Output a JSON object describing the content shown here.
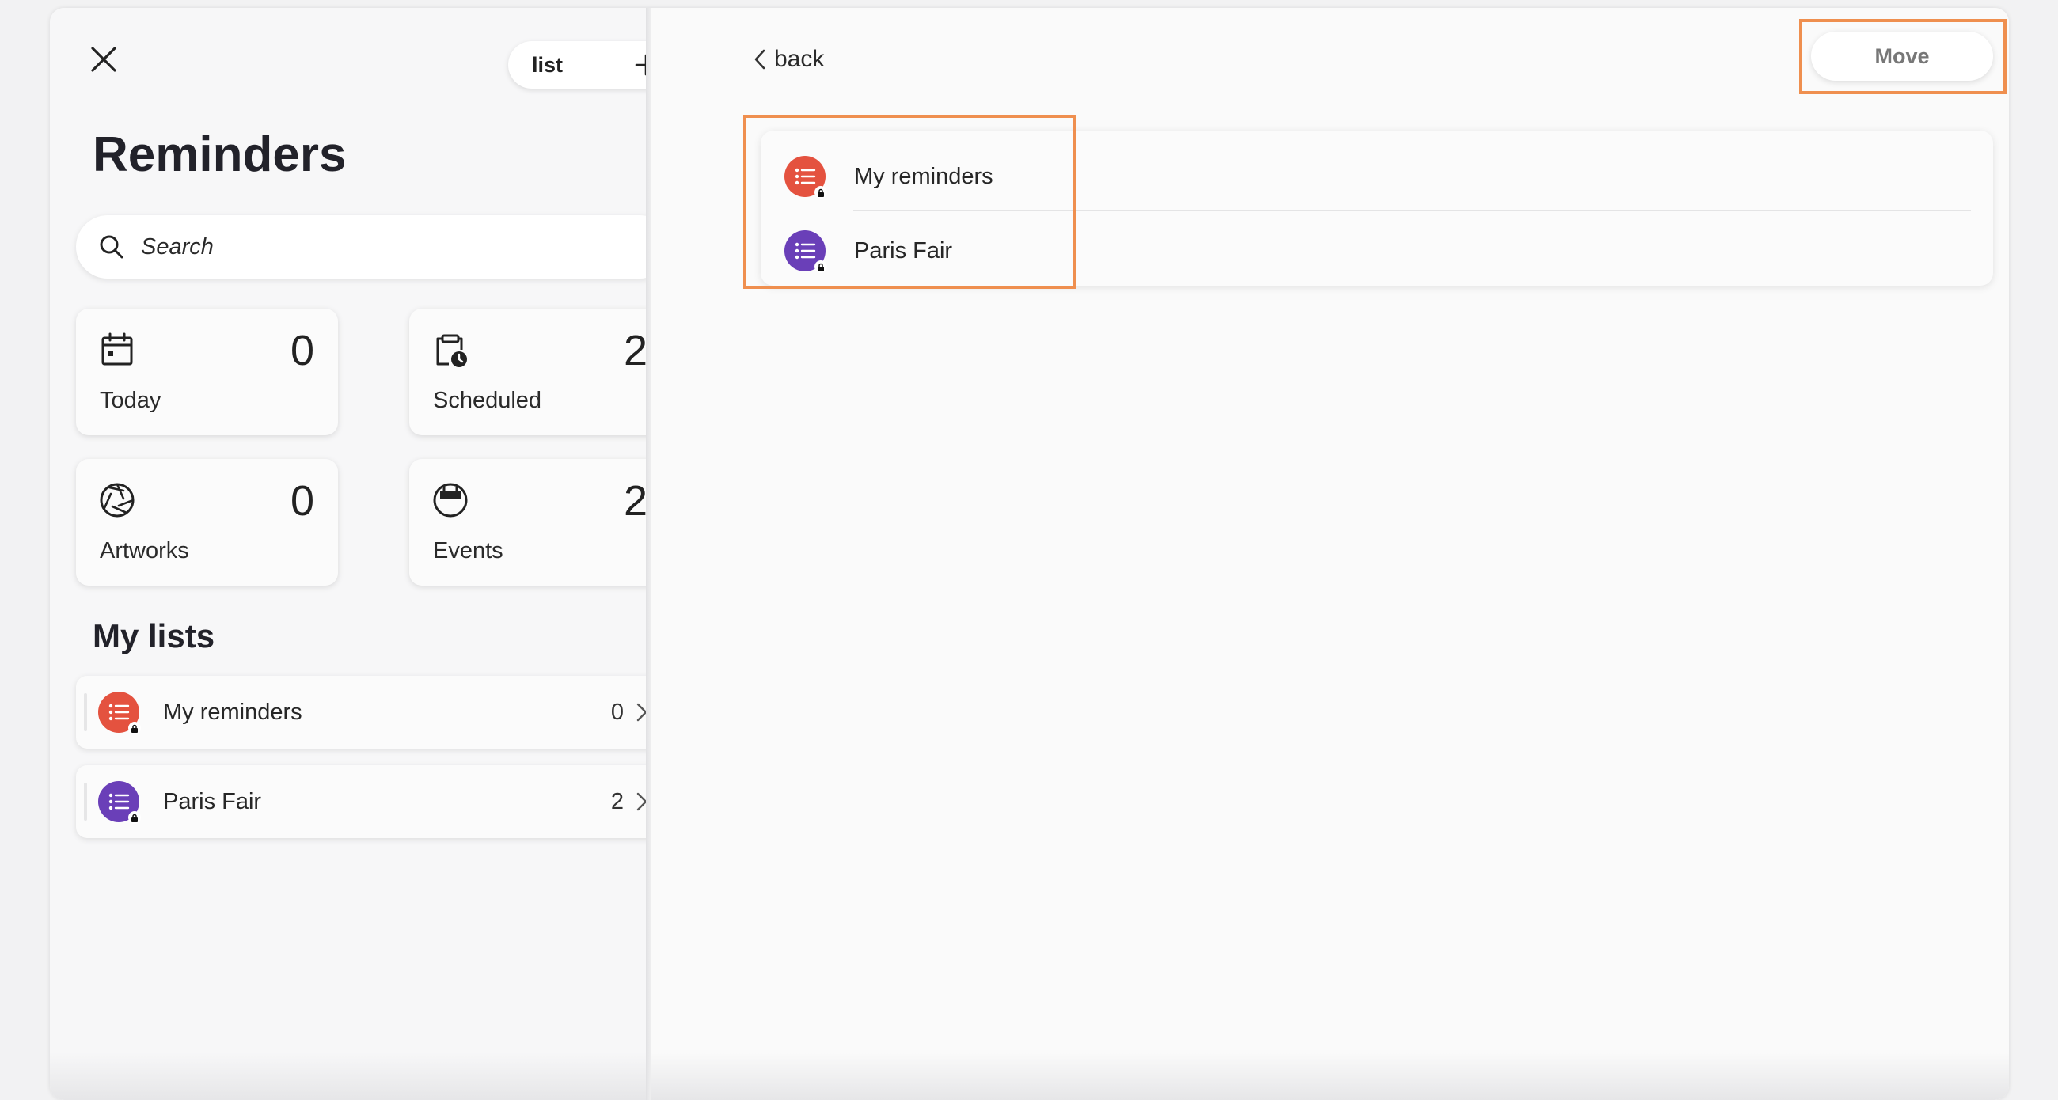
{
  "sidebar": {
    "new_list_label": "list",
    "title": "Reminders",
    "search": {
      "placeholder": "Search",
      "value": ""
    },
    "smart_lists": [
      {
        "label": "Today",
        "count": "0",
        "icon": "calendar-icon"
      },
      {
        "label": "Scheduled",
        "count": "2",
        "icon": "clipboard-clock-icon"
      },
      {
        "label": "Artworks",
        "count": "0",
        "icon": "aperture-icon"
      },
      {
        "label": "Events",
        "count": "2",
        "icon": "event-calendar-icon"
      }
    ],
    "my_lists_title": "My lists",
    "my_lists": [
      {
        "name": "My reminders",
        "count": "0",
        "color": "#e4523f"
      },
      {
        "name": "Paris Fair",
        "count": "2",
        "color": "#6a3fb8"
      }
    ]
  },
  "main": {
    "back_label": "back",
    "move_label": "Move",
    "destinations": [
      {
        "name": "My reminders",
        "color": "#e4523f"
      },
      {
        "name": "Paris Fair",
        "color": "#6a3fb8"
      }
    ]
  },
  "colors": {
    "highlight": "#ef8f4f",
    "list_red": "#e4523f",
    "list_purple": "#6a3fb8"
  }
}
